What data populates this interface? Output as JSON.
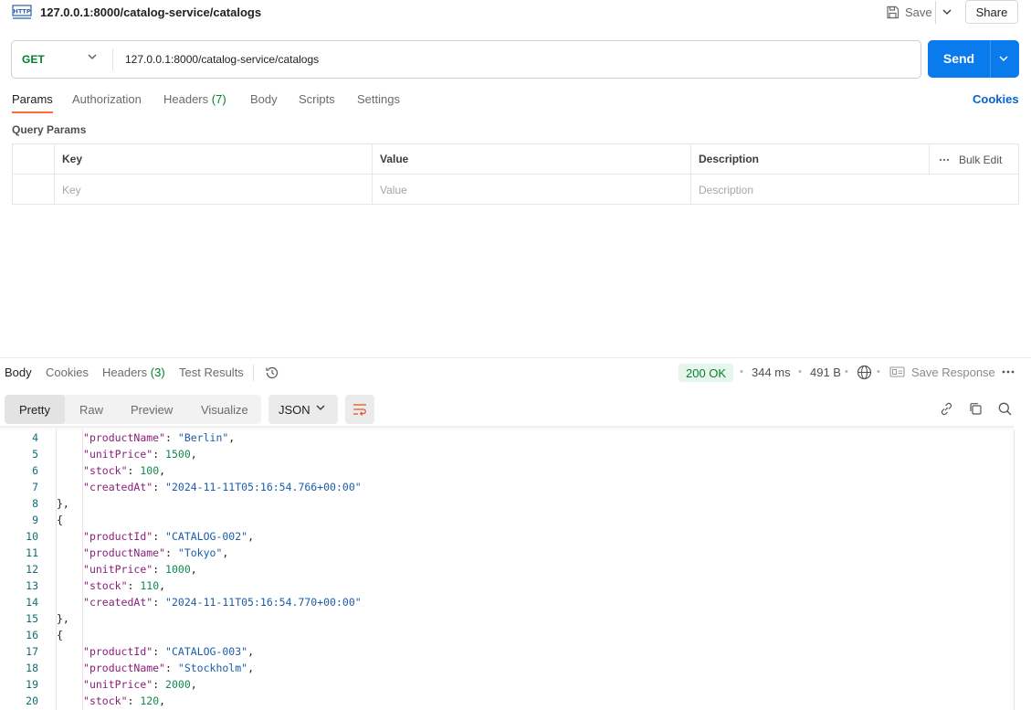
{
  "request": {
    "title": "127.0.0.1:8000/catalog-service/catalogs",
    "method": "GET",
    "url": "127.0.0.1:8000/catalog-service/catalogs",
    "save_label": "Save",
    "share_label": "Share",
    "send_label": "Send"
  },
  "request_tabs": [
    {
      "label": "Params",
      "count": ""
    },
    {
      "label": "Authorization",
      "count": ""
    },
    {
      "label": "Headers",
      "count": "(7)"
    },
    {
      "label": "Body",
      "count": ""
    },
    {
      "label": "Scripts",
      "count": ""
    },
    {
      "label": "Settings",
      "count": ""
    }
  ],
  "cookies_link": "Cookies",
  "query_params": {
    "section_label": "Query Params",
    "columns": [
      "Key",
      "Value",
      "Description"
    ],
    "bulk_edit": "Bulk Edit",
    "placeholders": [
      "Key",
      "Value",
      "Description"
    ]
  },
  "response_tabs": [
    {
      "label": "Body",
      "count": ""
    },
    {
      "label": "Cookies",
      "count": ""
    },
    {
      "label": "Headers",
      "count": "(3)"
    },
    {
      "label": "Test Results",
      "count": ""
    }
  ],
  "response_meta": {
    "status": "200 OK",
    "time": "344 ms",
    "size": "491 B",
    "save_response": "Save Response",
    "status_color": "#0a7d33"
  },
  "view_options": [
    "Pretty",
    "Raw",
    "Preview",
    "Visualize"
  ],
  "format": "JSON",
  "code_lines": [
    {
      "n": "4",
      "indent": 2,
      "key": "productName",
      "value": "\"Berlin\"",
      "type": "s",
      "comma": true
    },
    {
      "n": "5",
      "indent": 2,
      "key": "unitPrice",
      "value": "1500",
      "type": "n",
      "comma": true
    },
    {
      "n": "6",
      "indent": 2,
      "key": "stock",
      "value": "100",
      "type": "n",
      "comma": true
    },
    {
      "n": "7",
      "indent": 2,
      "key": "createdAt",
      "value": "\"2024-11-11T05:16:54.766+00:00\"",
      "type": "s",
      "comma": false
    },
    {
      "n": "8",
      "indent": 1,
      "text": "},"
    },
    {
      "n": "9",
      "indent": 1,
      "text": "{"
    },
    {
      "n": "10",
      "indent": 2,
      "key": "productId",
      "value": "\"CATALOG-002\"",
      "type": "s",
      "comma": true
    },
    {
      "n": "11",
      "indent": 2,
      "key": "productName",
      "value": "\"Tokyo\"",
      "type": "s",
      "comma": true
    },
    {
      "n": "12",
      "indent": 2,
      "key": "unitPrice",
      "value": "1000",
      "type": "n",
      "comma": true
    },
    {
      "n": "13",
      "indent": 2,
      "key": "stock",
      "value": "110",
      "type": "n",
      "comma": true
    },
    {
      "n": "14",
      "indent": 2,
      "key": "createdAt",
      "value": "\"2024-11-11T05:16:54.770+00:00\"",
      "type": "s",
      "comma": false
    },
    {
      "n": "15",
      "indent": 1,
      "text": "},"
    },
    {
      "n": "16",
      "indent": 1,
      "text": "{"
    },
    {
      "n": "17",
      "indent": 2,
      "key": "productId",
      "value": "\"CATALOG-003\"",
      "type": "s",
      "comma": true
    },
    {
      "n": "18",
      "indent": 2,
      "key": "productName",
      "value": "\"Stockholm\"",
      "type": "s",
      "comma": true
    },
    {
      "n": "19",
      "indent": 2,
      "key": "unitPrice",
      "value": "2000",
      "type": "n",
      "comma": true
    },
    {
      "n": "20",
      "indent": 2,
      "key": "stock",
      "value": "120",
      "type": "n",
      "comma": true
    }
  ]
}
